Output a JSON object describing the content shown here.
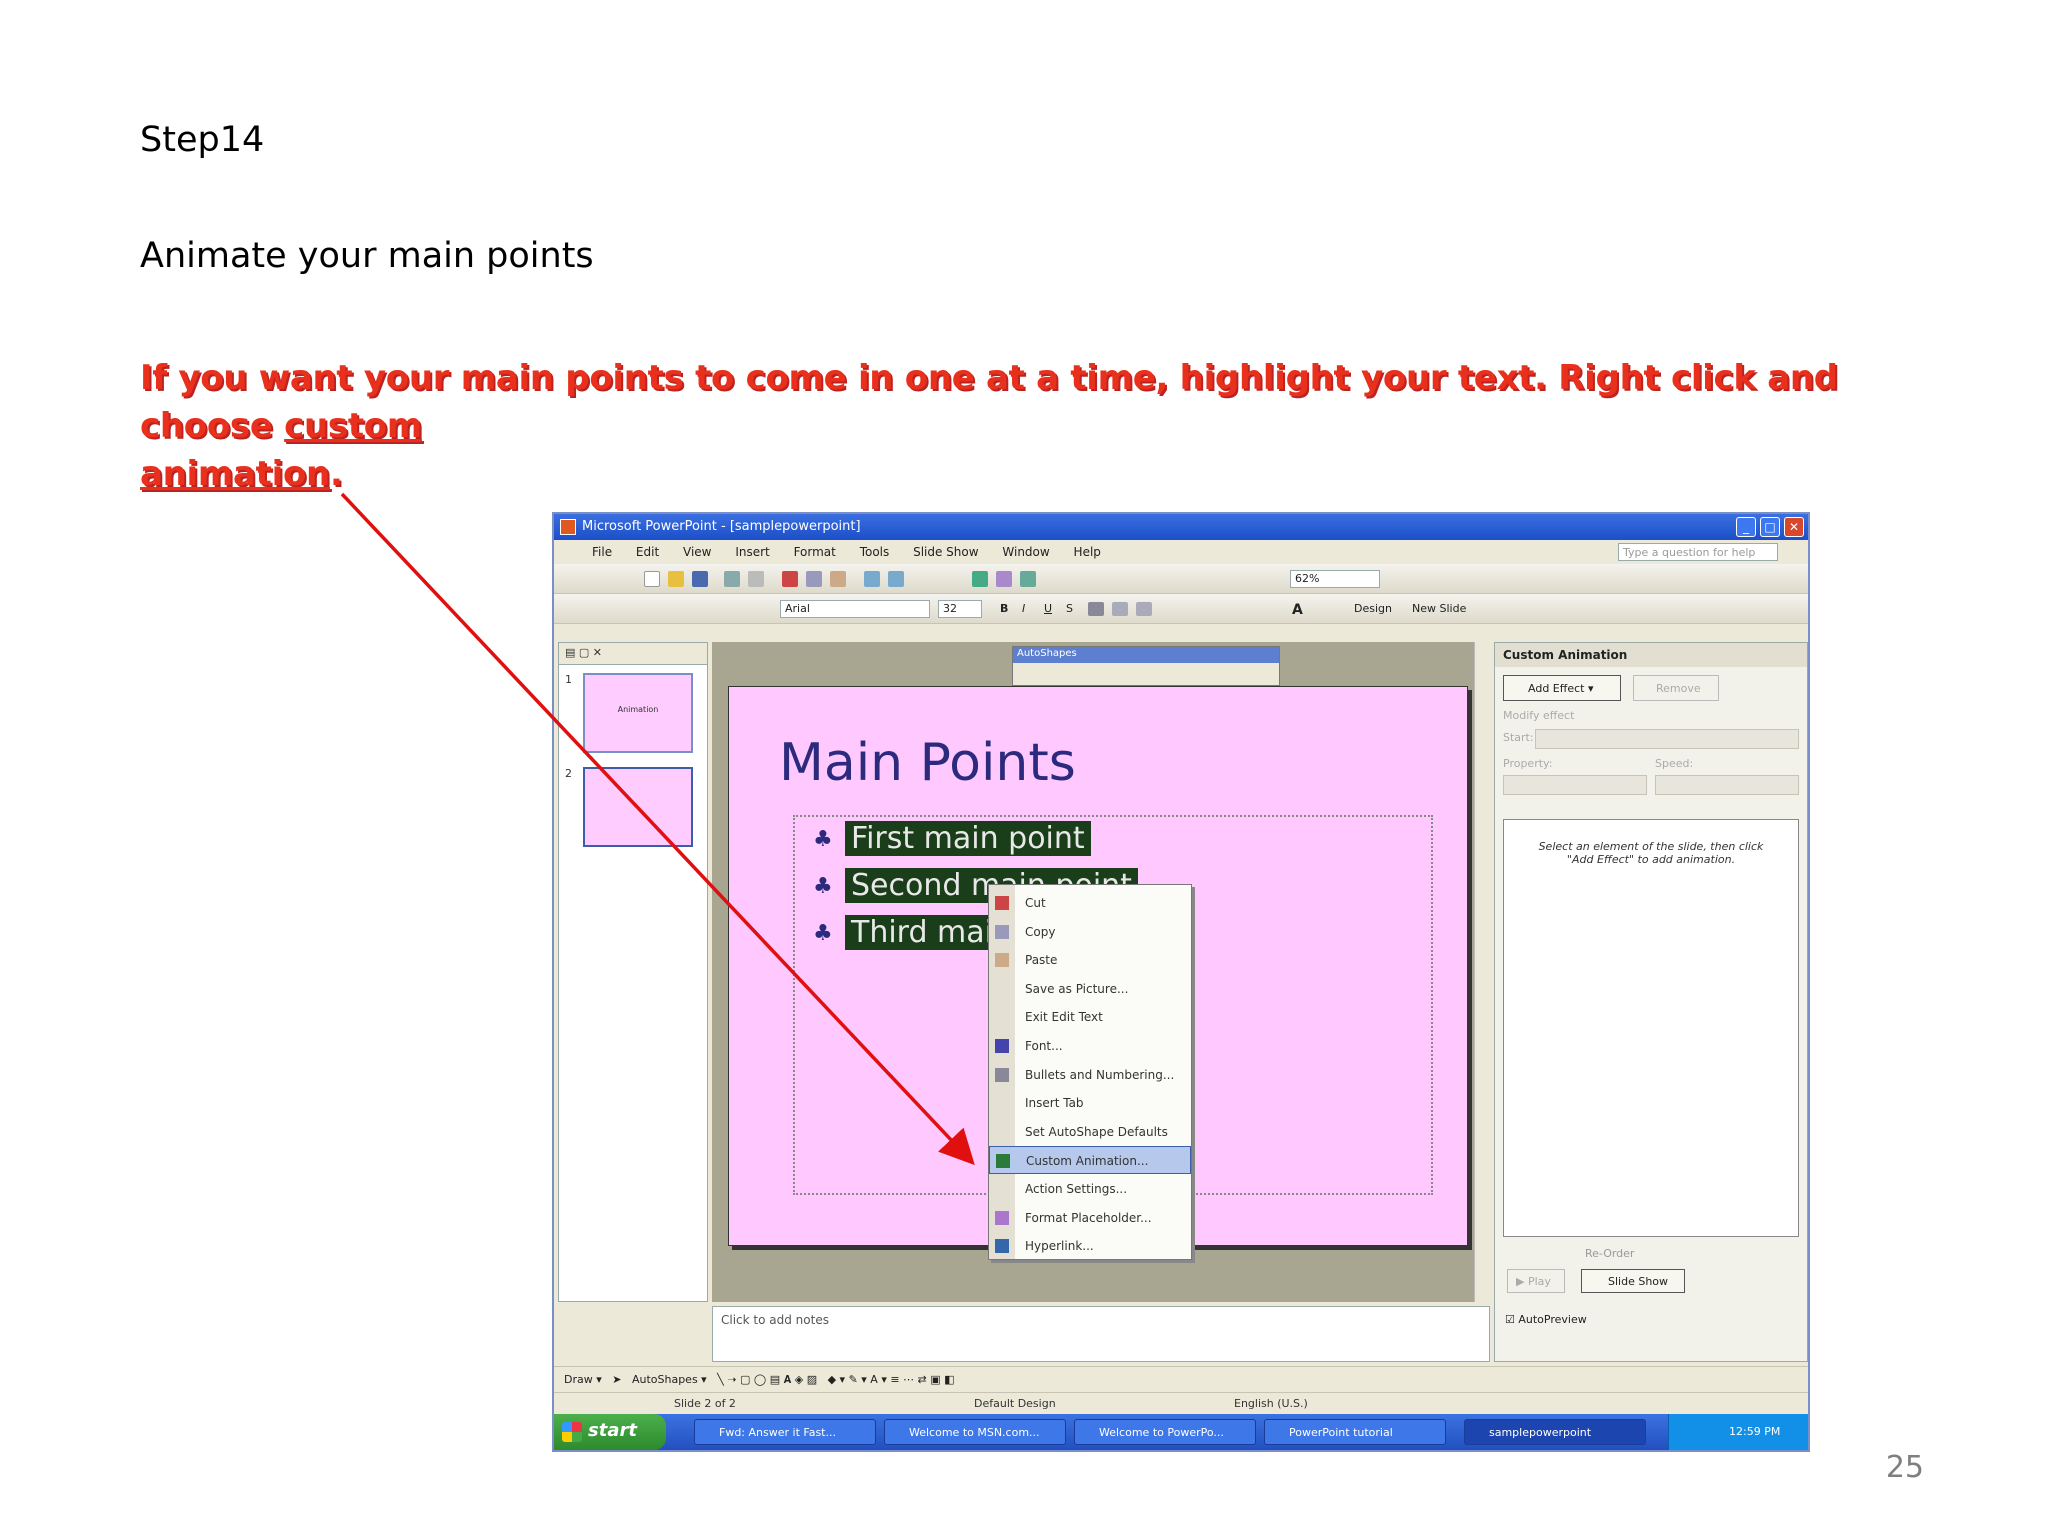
{
  "heading": {
    "step": "Step14",
    "subtitle": "Animate your main points"
  },
  "instruction": {
    "pre": " If you want your main points to come in one at a time, highlight your text. Right click and choose ",
    "link1": "custom",
    "link2": "animation",
    "post": "."
  },
  "page_number": "25",
  "colors": {
    "instruction": "#e8301c",
    "arrow": "#e01010",
    "slide_bg": "#ffc8ff",
    "title_blue": "#2c2a7c"
  },
  "window": {
    "title": "Microsoft PowerPoint - [samplepowerpoint]",
    "help_placeholder": "Type a question for help"
  },
  "menu": [
    "File",
    "Edit",
    "View",
    "Insert",
    "Format",
    "Tools",
    "Slide Show",
    "Window",
    "Help"
  ],
  "format_bar": {
    "font": "Arial",
    "size": "32",
    "zoom": "62%",
    "design_label": "Design",
    "new_slide_label": "New Slide"
  },
  "slides_pane": {
    "thumb1_title": "Animation",
    "thumb1_num": "1",
    "thumb2_num": "2"
  },
  "slide": {
    "title": "Main Points",
    "bullets": [
      "First main point",
      "Second main point",
      "Third main point"
    ],
    "autoshapes_title": "AutoShapes"
  },
  "context_menu": [
    {
      "label": "Cut",
      "icon": "scissors-icon"
    },
    {
      "label": "Copy",
      "icon": "copy-icon"
    },
    {
      "label": "Paste",
      "icon": "paste-icon"
    },
    {
      "label": "Save as Picture...",
      "icon": ""
    },
    {
      "label": "Exit Edit Text",
      "icon": ""
    },
    {
      "label": "Font...",
      "icon": "font-icon"
    },
    {
      "label": "Bullets and Numbering...",
      "icon": "bullets-icon"
    },
    {
      "label": "Insert Tab",
      "icon": ""
    },
    {
      "label": "Set AutoShape Defaults",
      "icon": ""
    },
    {
      "label": "Custom Animation...",
      "icon": "animation-icon",
      "highlighted": true
    },
    {
      "label": "Action Settings...",
      "icon": ""
    },
    {
      "label": "Format Placeholder...",
      "icon": "format-icon"
    },
    {
      "label": "Hyperlink...",
      "icon": "hyperlink-icon"
    }
  ],
  "notes_placeholder": "Click to add notes",
  "task_pane": {
    "title": "Custom Animation",
    "add_effect": "Add Effect",
    "remove": "Remove",
    "modify_label": "Modify effect",
    "start_label": "Start:",
    "property_label": "Property:",
    "speed_label": "Speed:",
    "hint": "Select an element of the slide, then click \"Add Effect\" to add animation.",
    "reorder": "Re-Order",
    "play": "Play",
    "slideshow": "Slide Show",
    "autopreview": "AutoPreview"
  },
  "drawing_bar": {
    "draw": "Draw",
    "autoshapes": "AutoShapes"
  },
  "status_bar": {
    "slide": "Slide 2 of 2",
    "design": "Default Design",
    "language": "English (U.S.)"
  },
  "taskbar": {
    "start": "start",
    "tasks": [
      "Fwd: Answer it Fast...",
      "Welcome to MSN.com...",
      "Welcome to PowerPo...",
      "PowerPoint tutorial",
      "samplepowerpoint"
    ],
    "clock": "12:59 PM"
  }
}
